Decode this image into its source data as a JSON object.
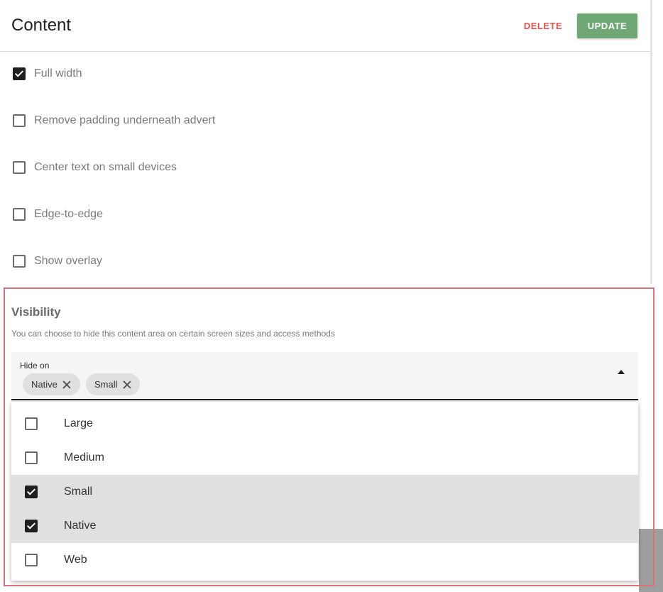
{
  "header": {
    "title": "Content",
    "delete_label": "DELETE",
    "update_label": "UPDATE"
  },
  "options": [
    {
      "label": "Full width",
      "checked": true
    },
    {
      "label": "Remove padding underneath advert",
      "checked": false
    },
    {
      "label": "Center text on small devices",
      "checked": false
    },
    {
      "label": "Edge-to-edge",
      "checked": false
    },
    {
      "label": "Show overlay",
      "checked": false
    }
  ],
  "visibility": {
    "title": "Visibility",
    "description": "You can choose to hide this content area on certain screen sizes and access methods",
    "select_label": "Hide on",
    "chips": [
      "Native",
      "Small"
    ],
    "menu_items": [
      {
        "label": "Large",
        "checked": false
      },
      {
        "label": "Medium",
        "checked": false
      },
      {
        "label": "Small",
        "checked": true
      },
      {
        "label": "Native",
        "checked": true
      },
      {
        "label": "Web",
        "checked": false
      }
    ]
  },
  "colors": {
    "update_button": "#6fa874",
    "delete_text": "#d9534f",
    "highlight_frame": "#d6747a"
  }
}
